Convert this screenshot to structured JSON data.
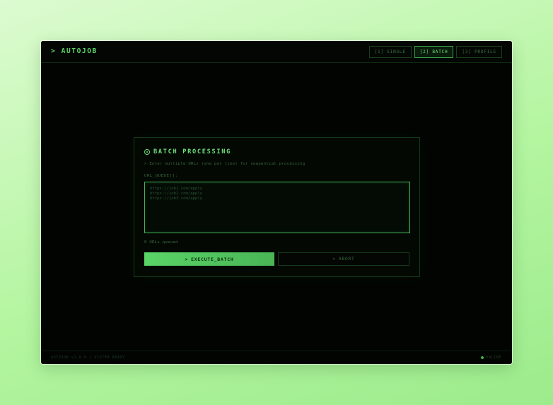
{
  "app": {
    "logo": "> AUTOJOB"
  },
  "nav": {
    "items": [
      {
        "label": "[1] SINGLE",
        "active": false
      },
      {
        "label": "[2] BATCH",
        "active": true
      },
      {
        "label": "[3] PROFILE",
        "active": false
      }
    ]
  },
  "panel": {
    "title": "BATCH PROCESSING",
    "description": "> Enter multiple URLs (one per line) for sequential processing",
    "field_label": "URL_QUEUE[]:",
    "url_value": "",
    "url_placeholder": "https://job1.com/apply\nhttps://job2.com/apply\nhttps://job3.com/apply",
    "queue_status": "0 URLs queued",
    "execute_label": "EXECUTE_BATCH",
    "execute_icon": "chevron-right-icon",
    "abort_label": "ABORT",
    "abort_icon": "close-icon"
  },
  "footer": {
    "left": "AUTOJOB v1.0.0 | SYSTEM READY",
    "status": "ONLINE"
  },
  "colors": {
    "accent": "#5fd76b",
    "background": "#020402",
    "border": "#163a18"
  }
}
